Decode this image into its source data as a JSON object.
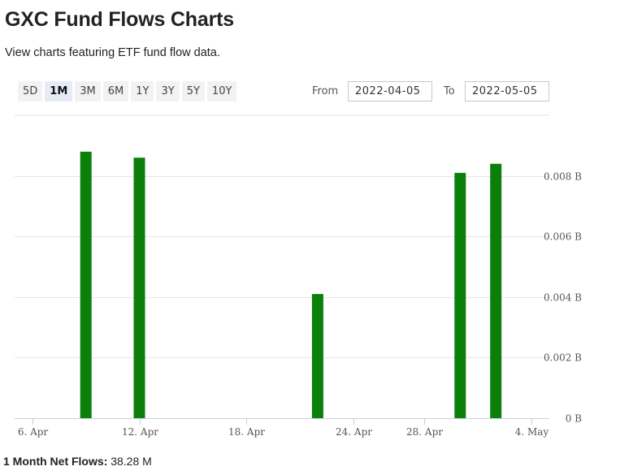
{
  "page": {
    "title": "GXC Fund Flows Charts",
    "subtitle": "View charts featuring ETF fund flow data."
  },
  "controls": {
    "ranges": [
      "5D",
      "1M",
      "3M",
      "6M",
      "1Y",
      "3Y",
      "5Y",
      "10Y"
    ],
    "active_range": "1M",
    "from_label": "From",
    "from_value": "2022-04-05",
    "to_label": "To",
    "to_value": "2022-05-05"
  },
  "colors": {
    "bar": "#0a800a",
    "grid": "#e6e6e6",
    "axis": "#c6d1e0",
    "tick_text": "#555555"
  },
  "chart_data": {
    "type": "bar",
    "title": "",
    "xlabel": "",
    "ylabel": "",
    "x_domain": [
      "2022-04-05",
      "2022-05-05"
    ],
    "xticks": [
      {
        "date": "2022-04-06",
        "label": "6. Apr"
      },
      {
        "date": "2022-04-12",
        "label": "12. Apr"
      },
      {
        "date": "2022-04-18",
        "label": "18. Apr"
      },
      {
        "date": "2022-04-24",
        "label": "24. Apr"
      },
      {
        "date": "2022-04-28",
        "label": "28. Apr"
      },
      {
        "date": "2022-05-04",
        "label": "4. May"
      }
    ],
    "ylim": [
      0,
      0.01
    ],
    "yticks": [
      {
        "value": 0,
        "label": "0 B"
      },
      {
        "value": 0.002,
        "label": "0.002 B"
      },
      {
        "value": 0.004,
        "label": "0.004 B"
      },
      {
        "value": 0.006,
        "label": "0.006 B"
      },
      {
        "value": 0.008,
        "label": "0.008 B"
      }
    ],
    "y_axis_position": "right",
    "grid": true,
    "units": "B",
    "points": [
      {
        "date": "2022-04-09",
        "value": 0.0088
      },
      {
        "date": "2022-04-12",
        "value": 0.0086
      },
      {
        "date": "2022-04-22",
        "value": 0.0041
      },
      {
        "date": "2022-04-30",
        "value": 0.0081
      },
      {
        "date": "2022-05-02",
        "value": 0.0084
      }
    ]
  },
  "summary": {
    "label": "1 Month Net Flows:",
    "value": "38.28 M"
  }
}
